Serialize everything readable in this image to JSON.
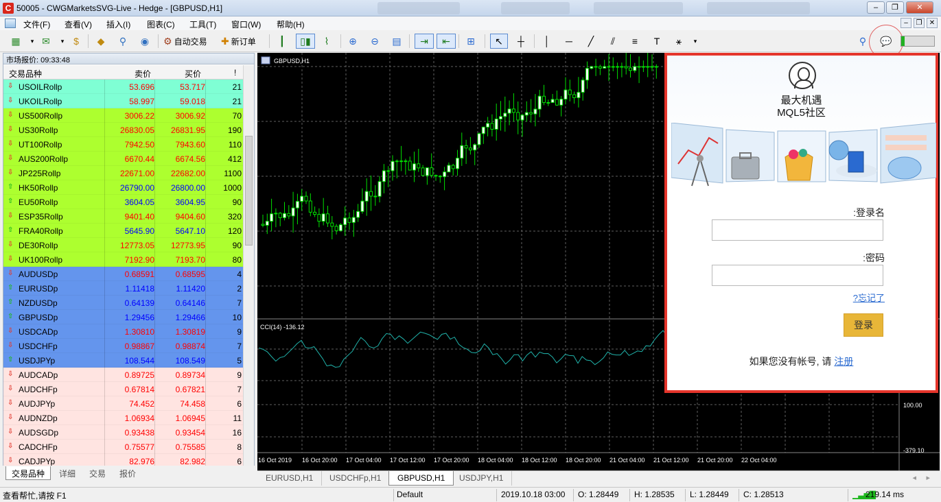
{
  "window": {
    "title": "50005 - CWGMarketsSVG-Live - Hedge - [GBPUSD,H1]",
    "app_icon": "C",
    "minimize": "–",
    "restore": "❐",
    "close": "✕"
  },
  "menu": [
    "文件(F)",
    "查看(V)",
    "插入(I)",
    "图表(C)",
    "工具(T)",
    "窗口(W)",
    "帮助(H)"
  ],
  "toolbar": {
    "autotrade_label": "自动交易",
    "neworder_label": "新订单"
  },
  "market_watch": {
    "header": "市场报价: 09:33:48",
    "columns": {
      "symbol": "交易品种",
      "bid": "卖价",
      "ask": "买价",
      "spread": "!"
    },
    "colors": {
      "commodity": "#7fffd4",
      "index": "#adff2f",
      "major": "#6495ed",
      "cross": "#ffe4e1",
      "up_price": "#0000ff",
      "down_price": "#ff0000",
      "up_arrow": "#1eb71e",
      "down_arrow": "#e03a2f"
    },
    "rows": [
      {
        "symbol": "USOILRollp",
        "bid": "53.696",
        "ask": "53.717",
        "spread": "21",
        "dir": "down",
        "group": "commodity"
      },
      {
        "symbol": "UKOILRollp",
        "bid": "58.997",
        "ask": "59.018",
        "spread": "21",
        "dir": "down",
        "group": "commodity"
      },
      {
        "symbol": "US500Rollp",
        "bid": "3006.22",
        "ask": "3006.92",
        "spread": "70",
        "dir": "down",
        "group": "index"
      },
      {
        "symbol": "US30Rollp",
        "bid": "26830.05",
        "ask": "26831.95",
        "spread": "190",
        "dir": "down",
        "group": "index"
      },
      {
        "symbol": "UT100Rollp",
        "bid": "7942.50",
        "ask": "7943.60",
        "spread": "110",
        "dir": "down",
        "group": "index"
      },
      {
        "symbol": "AUS200Rollp",
        "bid": "6670.44",
        "ask": "6674.56",
        "spread": "412",
        "dir": "down",
        "group": "index"
      },
      {
        "symbol": "JP225Rollp",
        "bid": "22671.00",
        "ask": "22682.00",
        "spread": "1100",
        "dir": "down",
        "group": "index"
      },
      {
        "symbol": "HK50Rollp",
        "bid": "26790.00",
        "ask": "26800.00",
        "spread": "1000",
        "dir": "up",
        "group": "index"
      },
      {
        "symbol": "EU50Rollp",
        "bid": "3604.05",
        "ask": "3604.95",
        "spread": "90",
        "dir": "up",
        "group": "index"
      },
      {
        "symbol": "ESP35Rollp",
        "bid": "9401.40",
        "ask": "9404.60",
        "spread": "320",
        "dir": "down",
        "group": "index"
      },
      {
        "symbol": "FRA40Rollp",
        "bid": "5645.90",
        "ask": "5647.10",
        "spread": "120",
        "dir": "up",
        "group": "index"
      },
      {
        "symbol": "DE30Rollp",
        "bid": "12773.05",
        "ask": "12773.95",
        "spread": "90",
        "dir": "down",
        "group": "index"
      },
      {
        "symbol": "UK100Rollp",
        "bid": "7192.90",
        "ask": "7193.70",
        "spread": "80",
        "dir": "down",
        "group": "index"
      },
      {
        "symbol": "AUDUSDp",
        "bid": "0.68591",
        "ask": "0.68595",
        "spread": "4",
        "dir": "down",
        "group": "major"
      },
      {
        "symbol": "EURUSDp",
        "bid": "1.11418",
        "ask": "1.11420",
        "spread": "2",
        "dir": "up",
        "group": "major"
      },
      {
        "symbol": "NZDUSDp",
        "bid": "0.64139",
        "ask": "0.64146",
        "spread": "7",
        "dir": "up",
        "group": "major"
      },
      {
        "symbol": "GBPUSDp",
        "bid": "1.29456",
        "ask": "1.29466",
        "spread": "10",
        "dir": "up",
        "group": "major"
      },
      {
        "symbol": "USDCADp",
        "bid": "1.30810",
        "ask": "1.30819",
        "spread": "9",
        "dir": "down",
        "group": "major"
      },
      {
        "symbol": "USDCHFp",
        "bid": "0.98867",
        "ask": "0.98874",
        "spread": "7",
        "dir": "down",
        "group": "major"
      },
      {
        "symbol": "USDJPYp",
        "bid": "108.544",
        "ask": "108.549",
        "spread": "5",
        "dir": "up",
        "group": "major"
      },
      {
        "symbol": "AUDCADp",
        "bid": "0.89725",
        "ask": "0.89734",
        "spread": "9",
        "dir": "down",
        "group": "cross"
      },
      {
        "symbol": "AUDCHFp",
        "bid": "0.67814",
        "ask": "0.67821",
        "spread": "7",
        "dir": "down",
        "group": "cross"
      },
      {
        "symbol": "AUDJPYp",
        "bid": "74.452",
        "ask": "74.458",
        "spread": "6",
        "dir": "down",
        "group": "cross"
      },
      {
        "symbol": "AUDNZDp",
        "bid": "1.06934",
        "ask": "1.06945",
        "spread": "11",
        "dir": "down",
        "group": "cross"
      },
      {
        "symbol": "AUDSGDp",
        "bid": "0.93438",
        "ask": "0.93454",
        "spread": "16",
        "dir": "down",
        "group": "cross"
      },
      {
        "symbol": "CADCHFp",
        "bid": "0.75577",
        "ask": "0.75585",
        "spread": "8",
        "dir": "down",
        "group": "cross"
      },
      {
        "symbol": "CADJPYp",
        "bid": "82.976",
        "ask": "82.982",
        "spread": "6",
        "dir": "down",
        "group": "cross"
      }
    ],
    "tabs": [
      "交易品种",
      "详细",
      "交易",
      "报价"
    ]
  },
  "chart": {
    "symbol_label": "GBPUSD,H1",
    "indicator_label": "CCI(14) -136.12",
    "indicator_levels": [
      "100.00",
      "-379.10"
    ],
    "time_labels": [
      "16 Oct 2019",
      "16 Oct 20:00",
      "17 Oct 04:00",
      "17 Oct 12:00",
      "17 Oct 20:00",
      "18 Oct 04:00",
      "18 Oct 12:00",
      "18 Oct 20:00",
      "21 Oct 04:00",
      "21 Oct 12:00",
      "21 Oct 20:00",
      "22 Oct 04:00"
    ],
    "colors": {
      "bg": "#000000",
      "bull": "#ffffff",
      "wick": "#00e000",
      "grid": "#606060",
      "cci": "#20b2aa",
      "axis_text": "#ffffff"
    },
    "tabs": [
      "EURUSD,H1",
      "USDCHFp,H1",
      "GBPUSD,H1",
      "USDJPY,H1"
    ],
    "active_tab": "GBPUSD,H1"
  },
  "login": {
    "title_line1": "最大机遇",
    "title_line2": "MQL5社区",
    "username_label": ":登录名",
    "password_label": ":密码",
    "forgot_label": "?忘记了",
    "login_button": "登录",
    "register_prefix": "如果您没有帐号, 请 ",
    "register_link": "注册",
    "border_color": "#e5352b",
    "button_color": "#e8b638"
  },
  "status": {
    "help": "查看帮忙,请按 F1",
    "profile": "Default",
    "datetime": "2019.10.18 03:00",
    "open": "O: 1.28449",
    "high": "H: 1.28535",
    "low": "L: 1.28449",
    "close": "C: 1.28513",
    "ping": "219.14 ms"
  }
}
